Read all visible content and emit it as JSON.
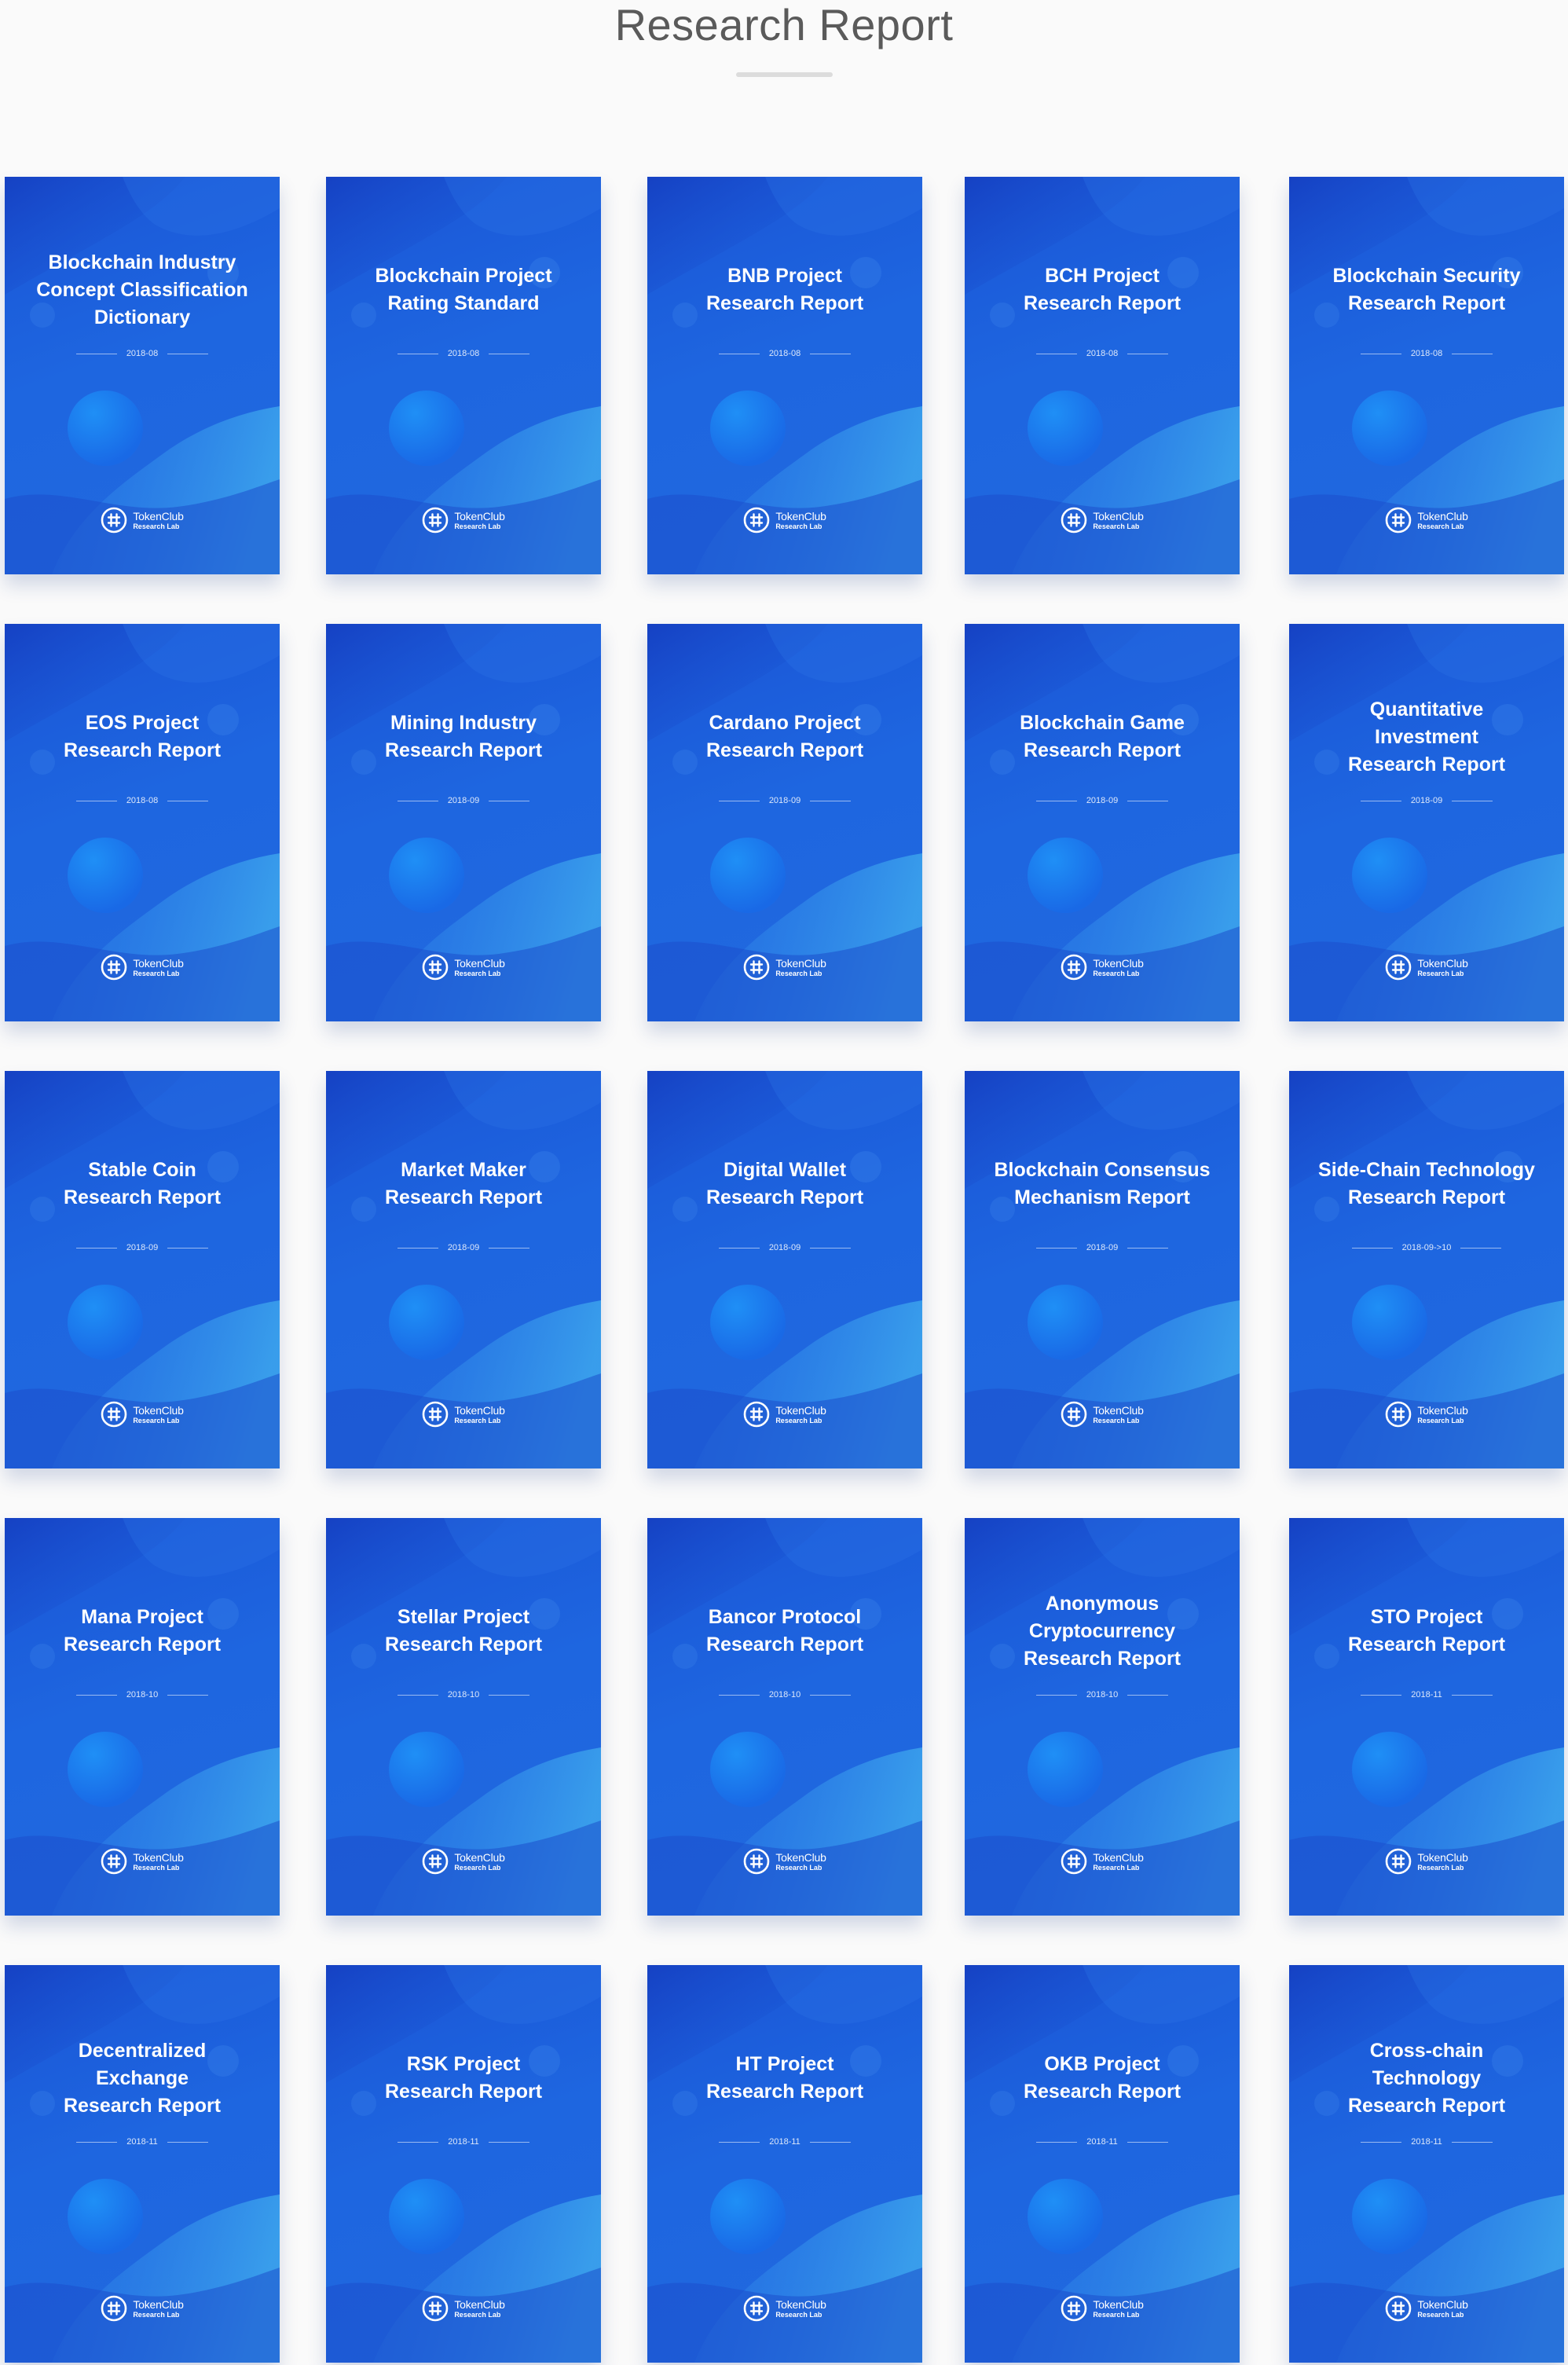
{
  "header": {
    "title": "Research Report"
  },
  "brand": {
    "name": "TokenClub",
    "sub": "Research Lab",
    "logo_icon": "tokenclub-logo-icon"
  },
  "colors": {
    "cover_blue": "#1e66e0",
    "cover_dark": "#1a4fcf",
    "title_text": "#5a5a5a"
  },
  "reports": [
    {
      "title": "Blockchain Industry\nConcept Classification\nDictionary",
      "date": "2018-08"
    },
    {
      "title": "Blockchain Project\nRating Standard",
      "date": "2018-08"
    },
    {
      "title": "BNB Project\nResearch Report",
      "date": "2018-08"
    },
    {
      "title": "BCH Project\nResearch Report",
      "date": "2018-08"
    },
    {
      "title": "Blockchain Security\nResearch Report",
      "date": "2018-08"
    },
    {
      "title": "EOS Project\nResearch Report",
      "date": "2018-08"
    },
    {
      "title": "Mining Industry\nResearch Report",
      "date": "2018-09"
    },
    {
      "title": "Cardano Project\nResearch Report",
      "date": "2018-09"
    },
    {
      "title": "Blockchain Game\nResearch Report",
      "date": "2018-09"
    },
    {
      "title": "Quantitative\nInvestment\nResearch Report",
      "date": "2018-09"
    },
    {
      "title": "Stable Coin\nResearch Report",
      "date": "2018-09"
    },
    {
      "title": "Market Maker\nResearch Report",
      "date": "2018-09"
    },
    {
      "title": "Digital Wallet\nResearch Report",
      "date": "2018-09"
    },
    {
      "title": "Blockchain Consensus\nMechanism Report",
      "date": "2018-09"
    },
    {
      "title": "Side-Chain Technology\nResearch Report",
      "date": "2018-09->10"
    },
    {
      "title": "Mana Project\nResearch Report",
      "date": "2018-10"
    },
    {
      "title": "Stellar Project\nResearch Report",
      "date": "2018-10"
    },
    {
      "title": "Bancor Protocol\nResearch Report",
      "date": "2018-10"
    },
    {
      "title": "Anonymous\nCryptocurrency\nResearch Report",
      "date": "2018-10"
    },
    {
      "title": "STO Project\nResearch Report",
      "date": "2018-11"
    },
    {
      "title": "Decentralized\nExchange\nResearch Report",
      "date": "2018-11"
    },
    {
      "title": "RSK Project\nResearch Report",
      "date": "2018-11"
    },
    {
      "title": "HT Project\nResearch Report",
      "date": "2018-11"
    },
    {
      "title": "OKB Project\nResearch Report",
      "date": "2018-11"
    },
    {
      "title": "Cross-chain\nTechnology\nResearch Report",
      "date": "2018-11"
    }
  ]
}
